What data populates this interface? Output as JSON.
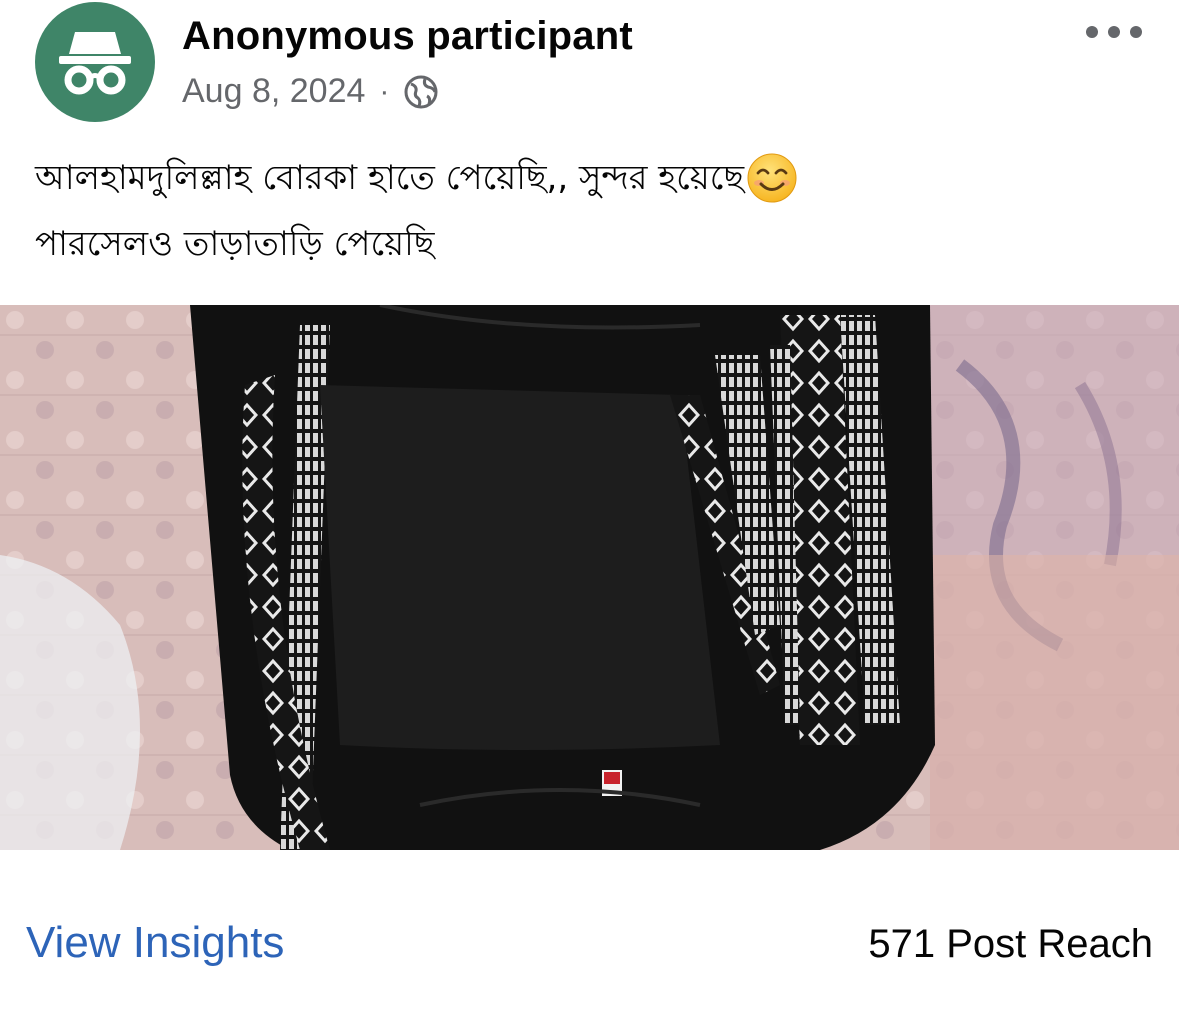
{
  "post": {
    "author": "Anonymous participant",
    "date": "Aug 8, 2024",
    "separator": "·",
    "visibility_icon": "globe-icon",
    "avatar_icon": "incognito-icon",
    "more_icon": "more-horizontal-icon",
    "caption_line1": "আলহামদুলিল্লাহ বোরকা হাতে পেয়েছি,, সুন্দর হয়েছে",
    "caption_line2": "পারসেলও তাড়াতাড়ি পেয়েছি",
    "caption_emoji": "smiling-face-icon",
    "photo_description_icon": "photo-black-borka-embroidered"
  },
  "footer": {
    "insights_label": "View Insights",
    "reach_label": "571 Post Reach"
  },
  "colors": {
    "avatar_bg": "#3f8568",
    "link": "#2d64b8",
    "secondary_text": "#65676b"
  }
}
